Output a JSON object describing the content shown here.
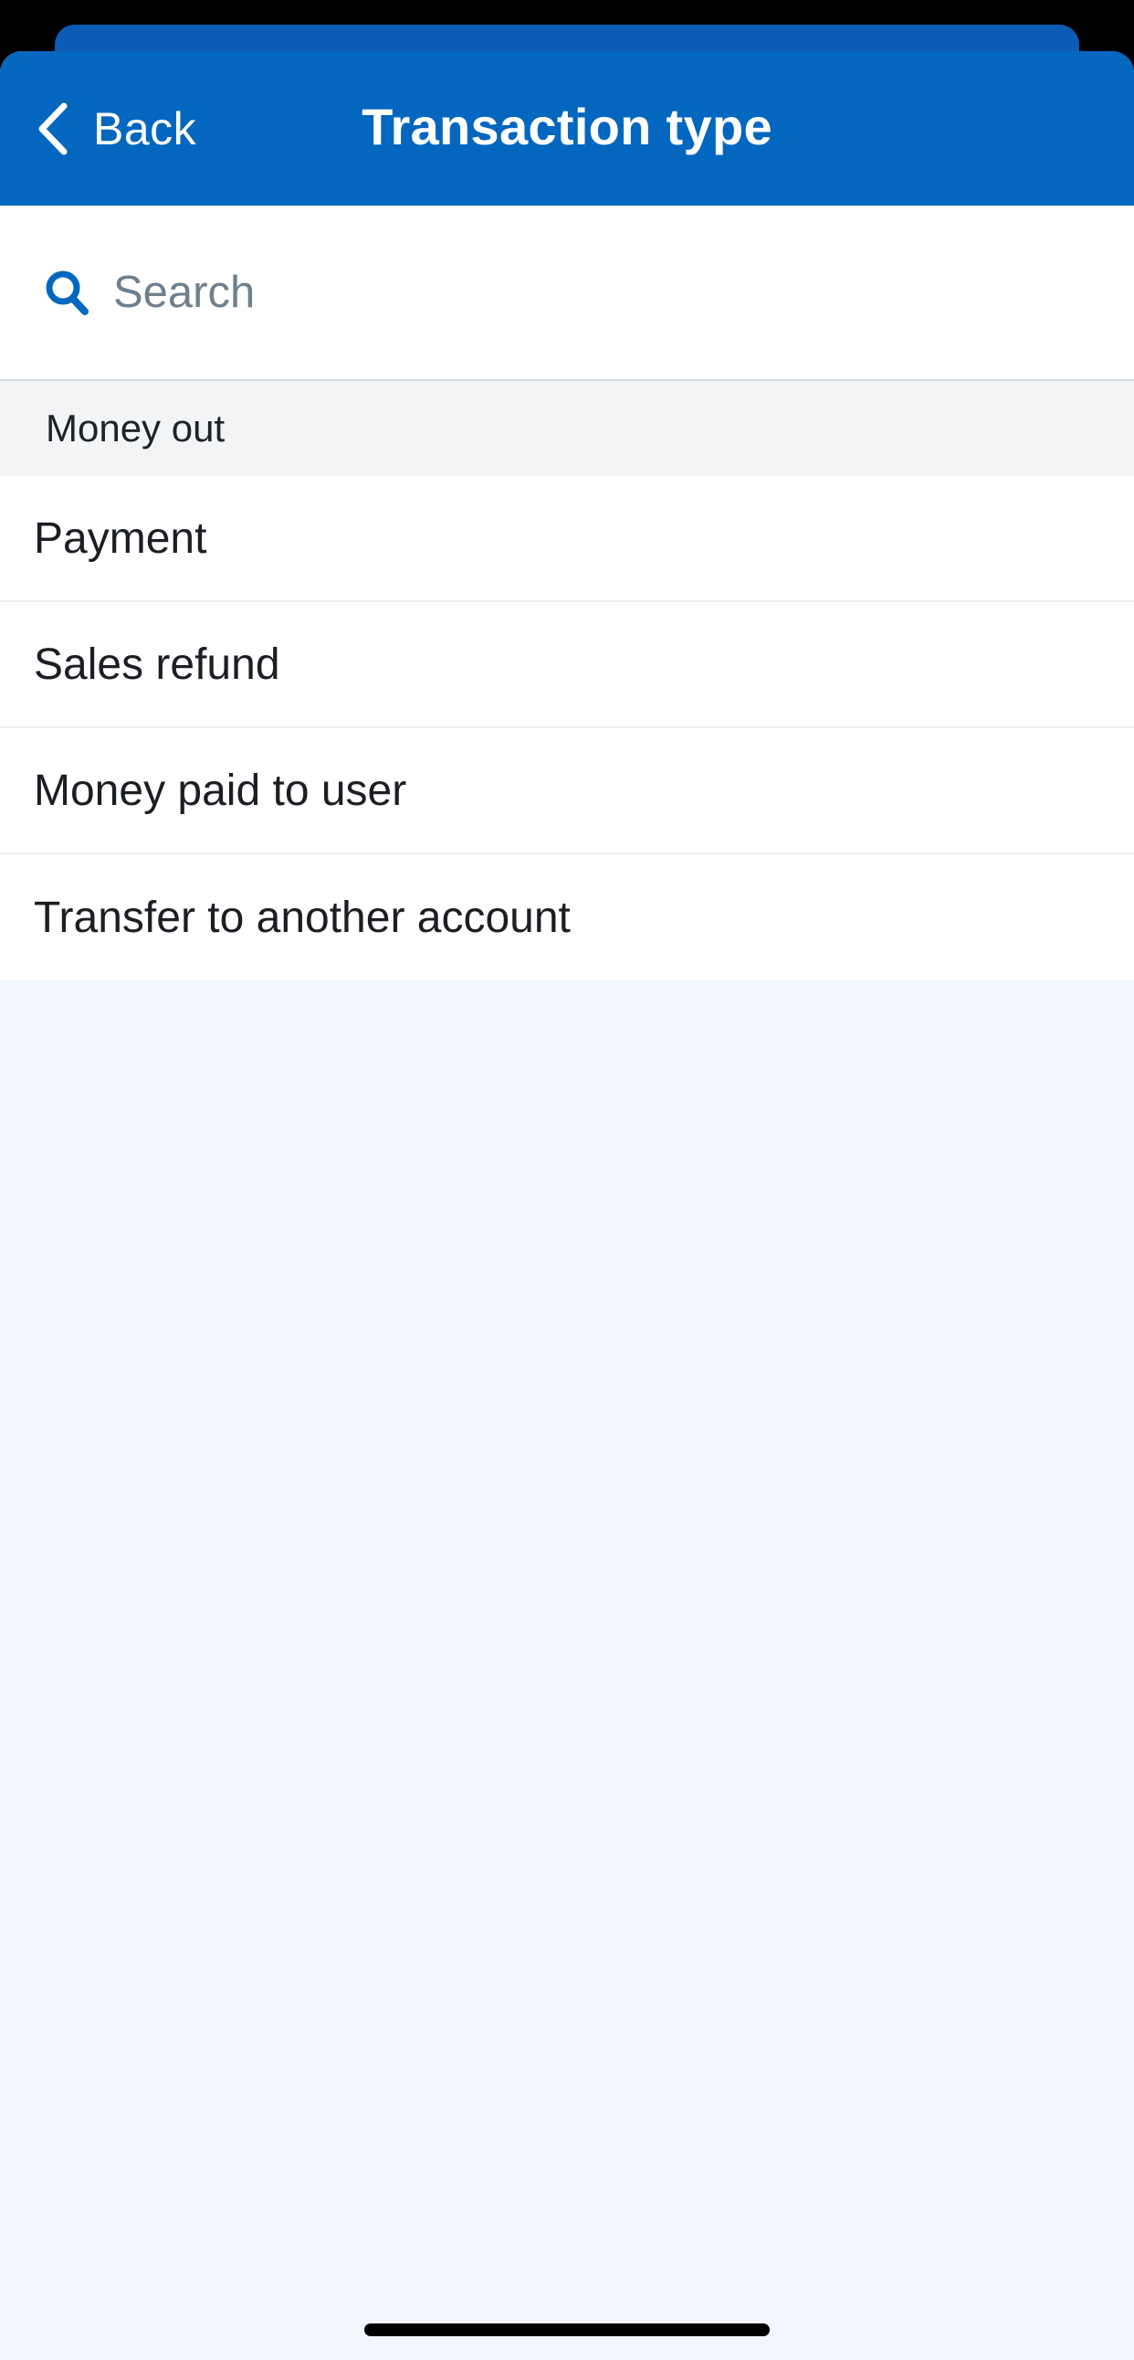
{
  "nav": {
    "back_label": "Back",
    "title": "Transaction type"
  },
  "search": {
    "placeholder": "Search",
    "value": ""
  },
  "section": {
    "title": "Money out"
  },
  "items": [
    {
      "label": "Payment"
    },
    {
      "label": "Sales refund"
    },
    {
      "label": "Money paid to user"
    },
    {
      "label": "Transfer to another account"
    }
  ],
  "colors": {
    "nav_background": "#0366BF",
    "accent": "#0366BF",
    "page_background": "#F2F6FD"
  }
}
